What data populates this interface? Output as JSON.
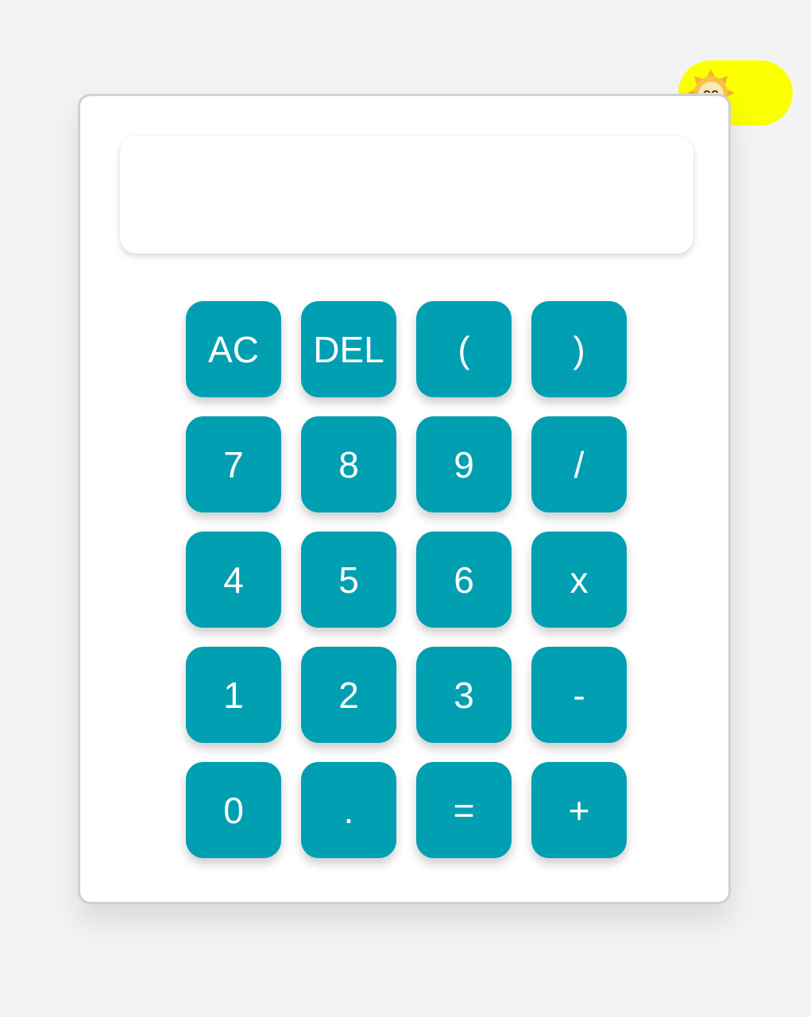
{
  "theme_toggle": {
    "state": "light",
    "icon": "sun-icon",
    "color": "#fbff00"
  },
  "display": {
    "value": ""
  },
  "colors": {
    "key_background": "#009fb2",
    "key_text": "#ffffff",
    "page_background": "#f3f3f3"
  },
  "keys": [
    {
      "label": "AC"
    },
    {
      "label": "DEL"
    },
    {
      "label": "("
    },
    {
      "label": ")"
    },
    {
      "label": "7"
    },
    {
      "label": "8"
    },
    {
      "label": "9"
    },
    {
      "label": "/"
    },
    {
      "label": "4"
    },
    {
      "label": "5"
    },
    {
      "label": "6"
    },
    {
      "label": "x"
    },
    {
      "label": "1"
    },
    {
      "label": "2"
    },
    {
      "label": "3"
    },
    {
      "label": "-"
    },
    {
      "label": "0"
    },
    {
      "label": "."
    },
    {
      "label": "="
    },
    {
      "label": "+"
    }
  ]
}
